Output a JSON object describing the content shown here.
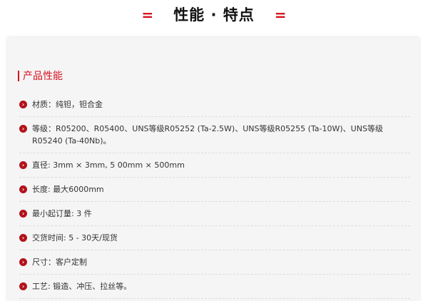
{
  "header": {
    "title": "性能 · 特点",
    "left_deco": "=",
    "right_deco": "="
  },
  "section": {
    "title": "产品性能"
  },
  "items": [
    "材质：纯钽，钽合金",
    "等级：R05200、R05400、UNS等级R05252 (Ta-2.5W)、UNS等级R05255 (Ta-10W)、UNS等级R05240 (Ta-40Nb)。",
    "直径: 3mm × 3mm, 5 00mm × 500mm",
    "长度: 最大6000mm",
    "最小起订量: 3 件",
    "交货时间: 5 - 30天/现货",
    "尺寸：客户定制",
    "工艺: 锻造、冲压、拉丝等。"
  ],
  "icons": {
    "bullet": "chevron-right-circle-icon"
  },
  "colors": {
    "accent": "#d4121f",
    "bullet": "#b3121c",
    "panel": "#f5f5f5"
  }
}
